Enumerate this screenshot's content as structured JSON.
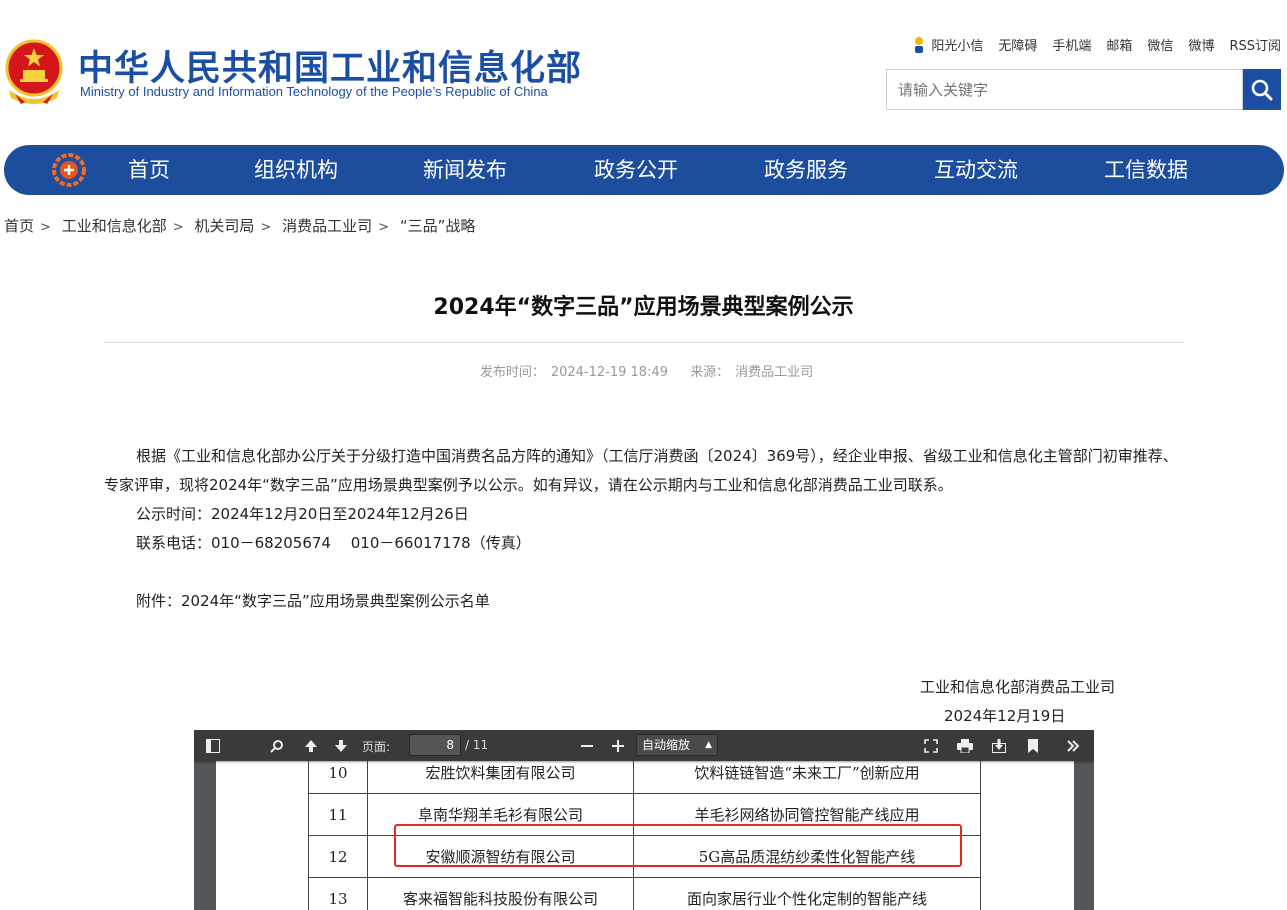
{
  "header": {
    "site_title": "中华人民共和国工业和信息化部",
    "site_subtitle": "Ministry of Industry and Information Technology of the People’s Republic of China",
    "links": [
      "阳光小信",
      "无障碍",
      "手机端",
      "邮箱",
      "微信",
      "微博",
      "RSS订阅"
    ],
    "search_placeholder": "请输入关键字"
  },
  "nav": {
    "items": [
      "首页",
      "组织机构",
      "新闻发布",
      "政务公开",
      "政务服务",
      "互动交流",
      "工信数据"
    ]
  },
  "breadcrumb": [
    "首页",
    "工业和信息化部",
    "机关司局",
    "消费品工业司",
    "“三品”战略"
  ],
  "article": {
    "title": "2024年“数字三品”应用场景典型案例公示",
    "publish_label": "发布时间：",
    "publish_time": "2024-12-19 18:49",
    "source_label": "来源：",
    "source": "消费品工业司",
    "paragraph": "根据《工业和信息化部办公厅关于分级打造中国消费名品方阵的通知》（工信厅消费函〔2024〕369号），经企业申报、省级工业和信息化主管部门初审推荐、专家评审，现将2024年“数字三品”应用场景典型案例予以公示。如有异议，请在公示期内与工业和信息化部消费品工业司联系。",
    "notice_period": "公示时间：2024年12月20日至2024年12月26日",
    "contact": "联系电话：010－68205674　 010－66017178（传真）",
    "attachment": "附件：2024年“数字三品”应用场景典型案例公示名单",
    "signature": "工业和信息化部消费品工业司",
    "sign_date": "2024年12月19日"
  },
  "pdf_viewer": {
    "page_label": "页面:",
    "current_page": "8",
    "total_pages": "/ 11",
    "zoom": "自动缩放",
    "rows": [
      {
        "no": "10",
        "company": "宏胜饮料集团有限公司",
        "project": "饮料链链智造“未来工厂”创新应用"
      },
      {
        "no": "11",
        "company": "阜南华翔羊毛衫有限公司",
        "project": "羊毛衫网络协同管控智能产线应用"
      },
      {
        "no": "12",
        "company": "安徽顺源智纺有限公司",
        "project": "5G高品质混纺纱柔性化智能产线"
      },
      {
        "no": "13",
        "company": "客来福智能科技股份有限公司",
        "project": "面向家居行业个性化定制的智能产线"
      }
    ],
    "highlight_color": "#e42a22"
  },
  "colors": {
    "brand_blue": "#1c4fa3",
    "nav_blue": "#1d4e9e"
  }
}
